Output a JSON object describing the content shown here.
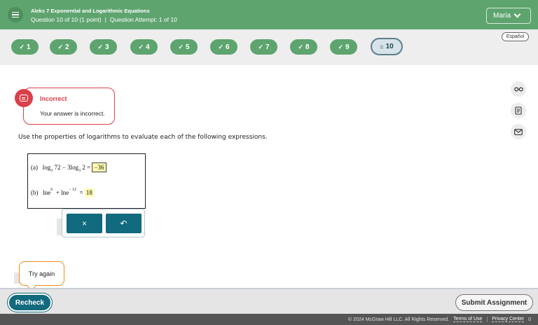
{
  "header": {
    "title": "Aleks 7 Exponential and Logarithmic Equations",
    "question_info": "Question 10 of 10 (1 point)",
    "separator": "|",
    "attempt_info": "Question Attempt: 1 of 10",
    "user_name": "Maria"
  },
  "nav": {
    "language_label": "Español",
    "questions": [
      {
        "label": "1",
        "status": "correct"
      },
      {
        "label": "2",
        "status": "correct"
      },
      {
        "label": "3",
        "status": "correct"
      },
      {
        "label": "4",
        "status": "correct"
      },
      {
        "label": "5",
        "status": "correct"
      },
      {
        "label": "6",
        "status": "correct"
      },
      {
        "label": "7",
        "status": "correct"
      },
      {
        "label": "8",
        "status": "correct"
      },
      {
        "label": "9",
        "status": "correct"
      },
      {
        "label": "10",
        "status": "current"
      }
    ]
  },
  "tools": {
    "items": [
      "glasses-icon",
      "notes-icon",
      "mail-icon"
    ]
  },
  "feedback": {
    "title": "Incorrect",
    "message": "Your answer is incorrect."
  },
  "question": {
    "instruction": "Use the properties of logarithms to evaluate each of the following expressions.",
    "part_a": {
      "label": "(a)",
      "log1": "log",
      "base1": "3",
      "arg1": "72",
      "minus": "− 3",
      "log2": "log",
      "base2": "3",
      "arg2": "2",
      "equals": "=",
      "answer": "−36"
    },
    "part_b": {
      "label": "(b)",
      "ln1": "ln",
      "e1": "e",
      "exp1": "6",
      "plus": "+",
      "ln2": "ln",
      "e2": "e",
      "exp2": "− 12",
      "equals": "=",
      "answer": "18"
    }
  },
  "answer_tools": {
    "clear_symbol": "×",
    "undo_symbol": "↶"
  },
  "try_again": "Try again",
  "actions": {
    "recheck": "Recheck",
    "submit": "Submit Assignment"
  },
  "footer": {
    "copyright": "© 2024 McGraw Hill LLC. All Rights Reserved.",
    "terms": "Terms of Use",
    "separator": "|",
    "privacy": "Privacy Center",
    "counter": "0"
  },
  "colors": {
    "header_green": "#5ea46f",
    "teal": "#116a7d",
    "error_red": "#d8414c",
    "hint_orange": "#f08a1c"
  }
}
